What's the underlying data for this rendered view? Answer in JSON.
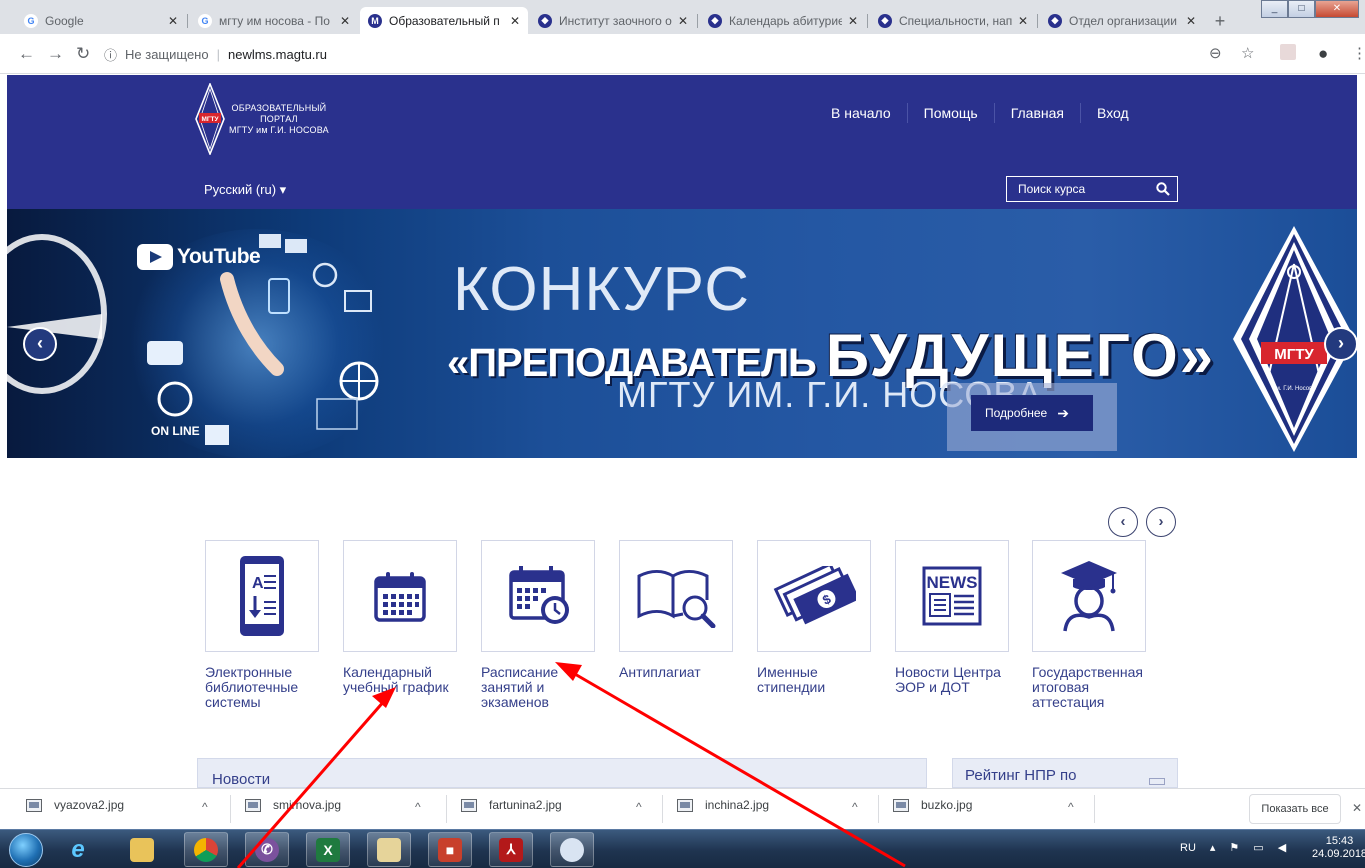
{
  "browser": {
    "tabs": [
      {
        "title": "Google",
        "favicon": "google-icon",
        "color": "#4285f4",
        "glyph": "G"
      },
      {
        "title": "мгту им носова - По",
        "favicon": "google-icon",
        "color": "#4285f4",
        "glyph": "G"
      },
      {
        "title": "Образовательный п",
        "favicon": "mgtu-icon",
        "color": "#2a318d",
        "glyph": "М"
      },
      {
        "title": "Институт заочного о",
        "favicon": "mgtu-round-icon",
        "color": "#2a318d",
        "glyph": "◆"
      },
      {
        "title": "Календарь абитурие",
        "favicon": "mgtu-round-icon",
        "color": "#2a318d",
        "glyph": "◆"
      },
      {
        "title": "Специальности, нап",
        "favicon": "mgtu-round-icon",
        "color": "#2a318d",
        "glyph": "◆"
      },
      {
        "title": "Отдел организации",
        "favicon": "mgtu-round-icon",
        "color": "#2a318d",
        "glyph": "◆"
      }
    ],
    "new_tab": "+",
    "security_label": "Не защищено",
    "url": "newlms.magtu.ru"
  },
  "header": {
    "logo_line1": "ОБРАЗОВАТЕЛЬНЫЙ",
    "logo_line2": "ПОРТАЛ",
    "logo_line3": "МГТУ им Г.И. НОСОВА",
    "logo_mark": "МГТУ",
    "nav": [
      "В начало",
      "Помощь",
      "Главная",
      "Вход"
    ],
    "language": "Русский (ru) ▾",
    "search_placeholder": "Поиск курса"
  },
  "banner": {
    "youtube": "YouTube",
    "online": "ON LINE",
    "contest": "КОНКУРС",
    "teacher": "«ПРЕПОДАВАТЕЛЬ",
    "future": "БУДУЩЕГО»",
    "university": "МГТУ ИМ. Г.И. НОСОВА",
    "more_button": "Подробнее",
    "seal_text": "МГТУ",
    "seal_ring": "им. Г.И. Носова"
  },
  "tiles": [
    {
      "label": "Электронные библиотечные системы",
      "icon": "tablet-document-icon"
    },
    {
      "label": "Календарный учебный график",
      "icon": "calendar-icon"
    },
    {
      "label": "Расписание занятий и экзаменов",
      "icon": "calendar-clock-icon"
    },
    {
      "label": "Антиплагиат",
      "icon": "book-magnifier-icon"
    },
    {
      "label": "Именные стипендии",
      "icon": "money-icon"
    },
    {
      "label": "Новости Центра ЭОР и ДОТ",
      "icon": "newspaper-icon"
    },
    {
      "label": "Государственная итоговая аттестация",
      "icon": "graduate-icon"
    }
  ],
  "news_icon_text": "NEWS",
  "blocks": {
    "news": "Новости",
    "rating": "Рейтинг НПР по"
  },
  "downloads": {
    "files": [
      "vyazova2.jpg",
      "smirnova.jpg",
      "fartunina2.jpg",
      "inchina2.jpg",
      "buzko.jpg"
    ],
    "show_all": "Показать все"
  },
  "taskbar": {
    "lang": "RU",
    "time": "15:43",
    "date": "24.09.2018"
  },
  "colors": {
    "header_bg": "#2a318d",
    "tile_text": "#343f8a",
    "annotation": "#ff0000"
  }
}
